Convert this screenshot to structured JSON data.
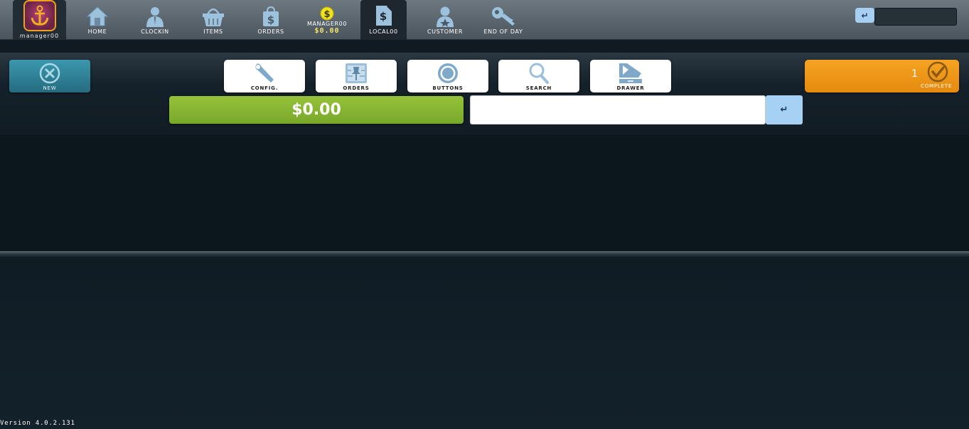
{
  "topbar": {
    "logo_label": "manager00",
    "nav": [
      {
        "label": "HOME",
        "icon": "home-icon"
      },
      {
        "label": "CLOCKIN",
        "icon": "person-icon"
      },
      {
        "label": "ITEMS",
        "icon": "basket-icon"
      },
      {
        "label": "ORDERS",
        "icon": "bag-dollar-icon"
      },
      {
        "label": "MANAGER00",
        "amount": "$0.00",
        "icon": "coin-icon"
      },
      {
        "label": "LOCAL00",
        "icon": "receipt-icon"
      },
      {
        "label": "CUSTOMER",
        "icon": "customer-icon"
      },
      {
        "label": "END OF DAY",
        "icon": "key-icon"
      }
    ],
    "enter_glyph": "↵"
  },
  "panel": {
    "new_label": "NEW",
    "tools": [
      {
        "label": "CONFIG.",
        "icon": "wrench-icon"
      },
      {
        "label": "ORDERS",
        "icon": "pin-board-icon"
      },
      {
        "label": "BUTTONS",
        "icon": "button-icon"
      },
      {
        "label": "SEARCH",
        "icon": "magnifier-icon"
      },
      {
        "label": "DRAWER",
        "icon": "drawer-icon"
      }
    ],
    "complete_label": "COMPLETE",
    "complete_count": "1",
    "total": "$0.00",
    "scan_value": "",
    "scan_enter_glyph": "↵"
  },
  "footer": {
    "version": "Version 4.0.2.131"
  },
  "colors": {
    "accent_green": "#8bbb33",
    "accent_orange": "#f29a1c",
    "accent_teal": "#2f8aa0",
    "icon_blue": "#8fb8d8"
  }
}
